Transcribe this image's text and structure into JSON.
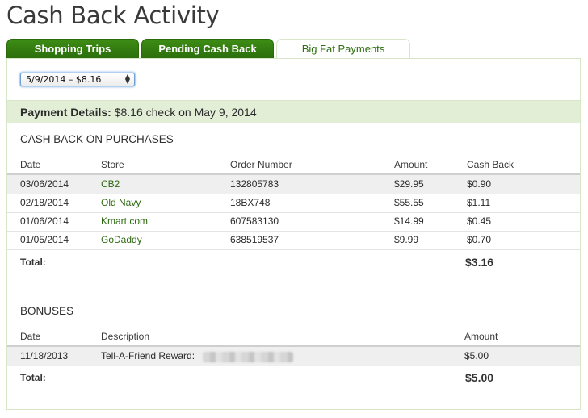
{
  "page": {
    "title": "Cash Back Activity"
  },
  "tabs": [
    {
      "label": "Shopping Trips"
    },
    {
      "label": "Pending Cash Back"
    },
    {
      "label": "Big Fat Payments"
    }
  ],
  "payment_select": {
    "value": "5/9/2014 – $8.16"
  },
  "payment_details": {
    "label": "Payment Details:",
    "text": "$8.16 check on May 9, 2014"
  },
  "purchases": {
    "heading": "CASH BACK ON PURCHASES",
    "columns": {
      "date": "Date",
      "store": "Store",
      "order": "Order Number",
      "amount": "Amount",
      "cashback": "Cash Back"
    },
    "rows": [
      {
        "date": "03/06/2014",
        "store": "CB2",
        "order": "132805783",
        "amount": "$29.95",
        "cashback": "$0.90"
      },
      {
        "date": "02/18/2014",
        "store": "Old Navy",
        "order": "18BX748",
        "amount": "$55.55",
        "cashback": "$1.11"
      },
      {
        "date": "01/06/2014",
        "store": "Kmart.com",
        "order": "607583130",
        "amount": "$14.99",
        "cashback": "$0.45"
      },
      {
        "date": "01/05/2014",
        "store": "GoDaddy",
        "order": "638519537",
        "amount": "$9.99",
        "cashback": "$0.70"
      }
    ],
    "total_label": "Total:",
    "total_value": "$3.16"
  },
  "bonuses": {
    "heading": "BONUSES",
    "columns": {
      "date": "Date",
      "description": "Description",
      "amount": "Amount"
    },
    "rows": [
      {
        "date": "11/18/2013",
        "description": "Tell-A-Friend Reward:",
        "amount": "$5.00"
      }
    ],
    "total_label": "Total:",
    "total_value": "$5.00"
  }
}
